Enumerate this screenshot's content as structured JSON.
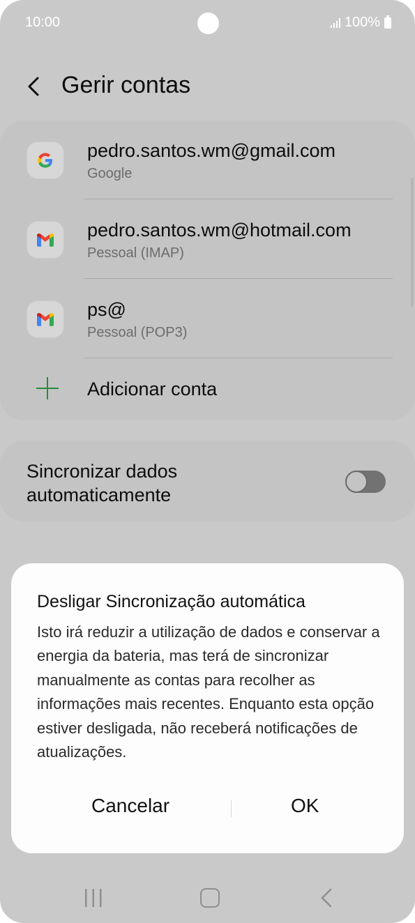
{
  "status_bar": {
    "time": "10:00",
    "battery": "100%"
  },
  "header": {
    "title": "Gerir contas"
  },
  "accounts": [
    {
      "email": "pedro.santos.wm@gmail.com",
      "type": "Google",
      "icon": "google-icon"
    },
    {
      "email": "pedro.santos.wm@hotmail.com",
      "type": "Pessoal (IMAP)",
      "icon": "gmail-icon"
    },
    {
      "email": "ps@",
      "type": "Pessoal (POP3)",
      "icon": "gmail-icon"
    }
  ],
  "add_account": {
    "label": "Adicionar conta"
  },
  "sync": {
    "label": "Sincronizar dados automaticamente",
    "enabled": false
  },
  "dialog": {
    "title": "Desligar Sincronização automática",
    "body": "Isto irá reduzir a utilização de dados e conservar a energia da bateria, mas terá de sincronizar manualmente as contas para recolher as informações mais recentes. Enquanto esta opção estiver desligada, não receberá notificações de atualizações.",
    "cancel_label": "Cancelar",
    "ok_label": "OK"
  },
  "colors": {
    "background_dim": "#c9c9c9",
    "accent_green": "#2a8a3f",
    "dialog_bg": "#fdfdfd"
  }
}
